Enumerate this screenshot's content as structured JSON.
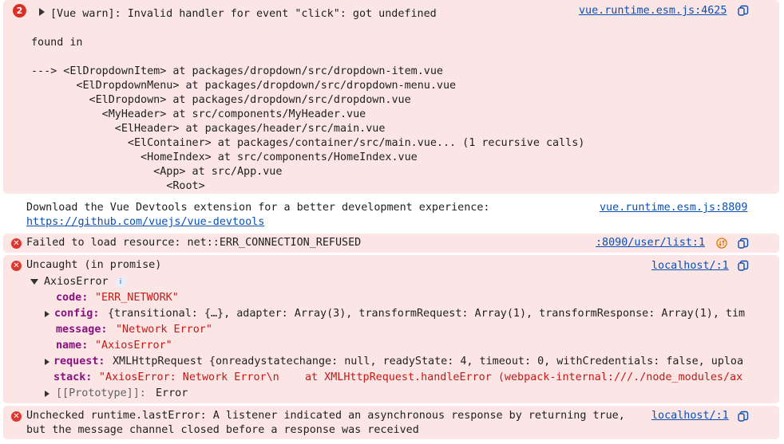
{
  "entries": {
    "vue_warn": {
      "count": "2",
      "message": "[Vue warn]: Invalid handler for event \"click\": got undefined",
      "source": "vue.runtime.esm.js:4625",
      "found_in": "found in",
      "trace": [
        "---> <ElDropdownItem> at packages/dropdown/src/dropdown-item.vue",
        "       <ElDropdownMenu> at packages/dropdown/src/dropdown-menu.vue",
        "         <ElDropdown> at packages/dropdown/src/dropdown.vue",
        "           <MyHeader> at src/components/MyHeader.vue",
        "             <ElHeader> at packages/header/src/main.vue",
        "               <ElContainer> at packages/container/src/main.vue... (1 recursive calls)",
        "                 <HomeIndex> at src/components/HomeIndex.vue",
        "                   <App> at src/App.vue",
        "                     <Root>"
      ]
    },
    "devtools": {
      "message": "Download the Vue Devtools extension for a better development experience:",
      "link": "https://github.com/vuejs/vue-devtools",
      "source": "vue.runtime.esm.js:8809"
    },
    "failed_load": {
      "message": "Failed to load resource: net::ERR_CONNECTION_REFUSED",
      "source": ":8090/user/list:1"
    },
    "uncaught": {
      "message": "Uncaught (in promise)",
      "source": "localhost/:1",
      "object_name": "AxiosError",
      "props": {
        "code_key": "code:",
        "code_val": "\"ERR_NETWORK\"",
        "config_key": "config:",
        "config_val": "{transitional: {…}, adapter: Array(3), transformRequest: Array(1), transformResponse: Array(1), tim",
        "message_key": "message:",
        "message_val": "\"Network Error\"",
        "name_key": "name:",
        "name_val": "\"AxiosError\"",
        "request_key": "request:",
        "request_val": "XMLHttpRequest {onreadystatechange: null, readyState: 4, timeout: 0, withCredentials: false, uploa",
        "stack_key": "stack:",
        "stack_val": "\"AxiosError: Network Error\\n    at XMLHttpRequest.handleError (webpack-internal:///./node_modules/ax",
        "proto_key": "[[Prototype]]:",
        "proto_val": "Error"
      }
    },
    "unchecked": {
      "line1": "Unchecked runtime.lastError: A listener indicated an asynchronous response by returning true,",
      "line2": "but the message channel closed before a response was received",
      "source": "localhost/:1"
    }
  },
  "colors": {
    "error_bg": "#fbe5e5",
    "link": "#0b4fb5",
    "key": "#881280",
    "string": "#c41a16",
    "number": "#1c00cf"
  },
  "icons": [
    "copy-icon",
    "error-icon",
    "expand-triangle-icon",
    "info-icon",
    "network-icon"
  ]
}
